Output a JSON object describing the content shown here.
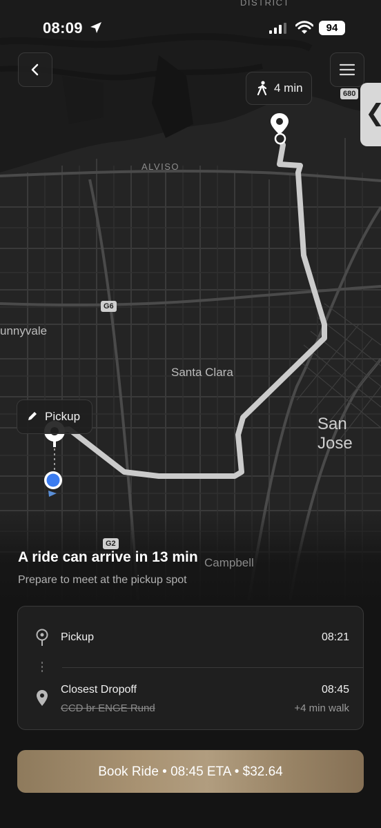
{
  "status_bar": {
    "time": "08:09",
    "battery": "94"
  },
  "map": {
    "labels": {
      "district": "DISTRICT",
      "alviso": "ALVISO",
      "sunnyvale": "unnyvale",
      "santa_clara": "Santa Clara",
      "san_jose": "San Jose",
      "campbell": "Campbell"
    },
    "shields": {
      "g6": "G6",
      "g2": "G2",
      "i680": "680"
    },
    "walk_chip": {
      "label": "4 min",
      "icon": "walking-person-icon"
    },
    "pickup_chip": {
      "label": "Pickup",
      "icon": "pencil-icon"
    },
    "side_tab_glyph": "❮",
    "colors": {
      "route": "#c8c8c8",
      "user_dot": "#3b7cf0",
      "map_bg": "#232323"
    }
  },
  "eta": {
    "title": "A ride can arrive in 13 min",
    "subtitle": "Prepare to meet at the pickup spot"
  },
  "trip": {
    "pickup": {
      "label": "Pickup",
      "time": "08:21"
    },
    "dropoff": {
      "label": "Closest Dropoff",
      "time": "08:45",
      "address": "CCD br ENGE Rund",
      "walk": "+4 min walk"
    }
  },
  "book_button": {
    "label": "Book Ride • 08:45 ETA • $32.64"
  }
}
